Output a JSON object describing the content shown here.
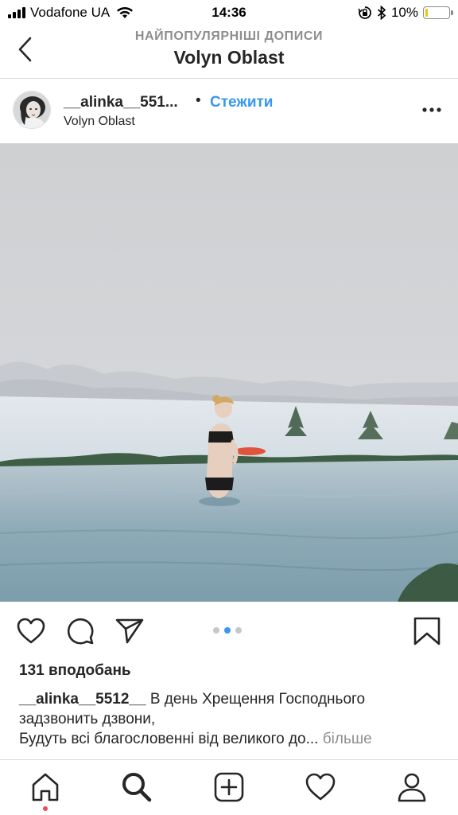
{
  "status_bar": {
    "carrier": "Vodafone UA",
    "time": "14:36",
    "battery_percent": "10%",
    "battery_level": 0.1,
    "icons": [
      "signal-icon",
      "wifi-icon",
      "rotation-lock-icon",
      "bluetooth-icon",
      "battery-icon"
    ]
  },
  "header": {
    "subtitle": "НАЙПОПУЛЯРНІШІ ДОПИСИ",
    "title": "Volyn Oblast",
    "back_icon": "chevron-left-icon"
  },
  "post": {
    "username": "__alinka__551...",
    "separator": "•",
    "follow_label": "Стежити",
    "location": "Volyn Oblast",
    "more_icon": "ellipsis-icon",
    "carousel": {
      "count": 3,
      "active": 2
    },
    "likes": "131 вподобань",
    "caption_user": "__alinka__5512__",
    "caption_line1": " В день Хрещення Господнього задзвонить дзвони,",
    "caption_line2": "Будуть всі благословенні від великого до...",
    "caption_more": "більше",
    "accent_color": "#3897f0"
  },
  "actions": [
    "heart-icon",
    "comment-icon",
    "share-icon",
    "bookmark-icon"
  ],
  "tabbar": [
    "home-icon",
    "search-icon",
    "add-post-icon",
    "activity-heart-icon",
    "profile-icon"
  ]
}
